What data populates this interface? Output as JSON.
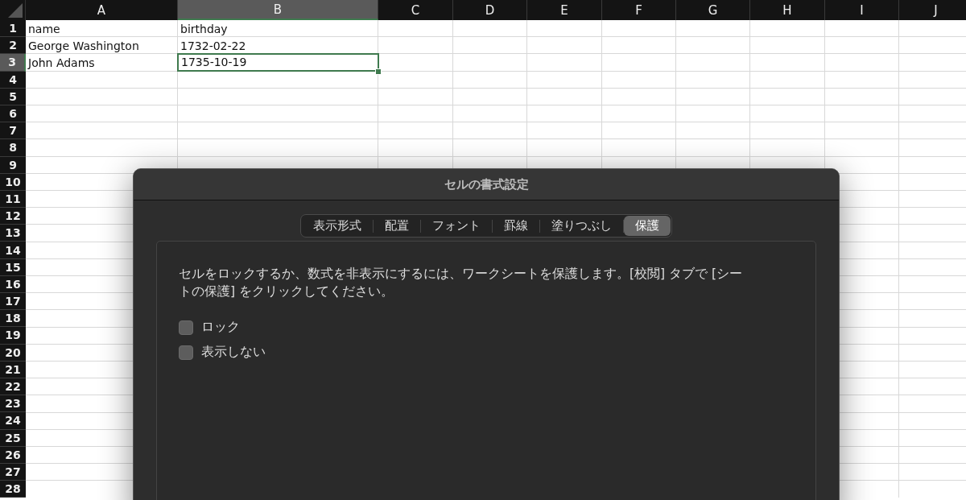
{
  "sheet": {
    "columns": [
      {
        "label": "A",
        "selected": false
      },
      {
        "label": "B",
        "selected": true
      },
      {
        "label": "C",
        "selected": false
      },
      {
        "label": "D",
        "selected": false
      },
      {
        "label": "E",
        "selected": false
      },
      {
        "label": "F",
        "selected": false
      },
      {
        "label": "G",
        "selected": false
      },
      {
        "label": "H",
        "selected": false
      },
      {
        "label": "I",
        "selected": false
      },
      {
        "label": "J",
        "selected": false
      }
    ],
    "rows": [
      {
        "label": "1",
        "selected": false,
        "cells": [
          {
            "text": "name",
            "selected": false
          },
          {
            "text": "birthday",
            "selected": false
          }
        ]
      },
      {
        "label": "2",
        "selected": false,
        "cells": [
          {
            "text": "George Washington",
            "selected": false
          },
          {
            "text": "1732-02-22",
            "selected": false
          }
        ]
      },
      {
        "label": "3",
        "selected": true,
        "cells": [
          {
            "text": "John Adams",
            "selected": false
          },
          {
            "text": "1735-10-19",
            "selected": true
          }
        ]
      },
      {
        "label": "4",
        "selected": false
      },
      {
        "label": "5",
        "selected": false
      },
      {
        "label": "6",
        "selected": false
      },
      {
        "label": "7",
        "selected": false
      },
      {
        "label": "8",
        "selected": false
      },
      {
        "label": "9",
        "selected": false
      },
      {
        "label": "10",
        "selected": false
      },
      {
        "label": "11",
        "selected": false
      },
      {
        "label": "12",
        "selected": false
      },
      {
        "label": "13",
        "selected": false
      },
      {
        "label": "14",
        "selected": false
      },
      {
        "label": "15",
        "selected": false
      },
      {
        "label": "16",
        "selected": false
      },
      {
        "label": "17",
        "selected": false
      },
      {
        "label": "18",
        "selected": false
      },
      {
        "label": "19",
        "selected": false
      },
      {
        "label": "20",
        "selected": false
      },
      {
        "label": "21",
        "selected": false
      },
      {
        "label": "22",
        "selected": false
      },
      {
        "label": "23",
        "selected": false
      },
      {
        "label": "24",
        "selected": false
      },
      {
        "label": "25",
        "selected": false
      },
      {
        "label": "26",
        "selected": false
      },
      {
        "label": "27",
        "selected": false
      },
      {
        "label": "28",
        "selected": false
      }
    ]
  },
  "dialog": {
    "title": "セルの書式設定",
    "tabs": [
      {
        "label": "表示形式",
        "selected": false
      },
      {
        "label": "配置",
        "selected": false
      },
      {
        "label": "フォント",
        "selected": false
      },
      {
        "label": "罫線",
        "selected": false
      },
      {
        "label": "塗りつぶし",
        "selected": false
      },
      {
        "label": "保護",
        "selected": true
      }
    ],
    "description": "セルをロックするか、数式を非表示にするには、ワークシートを保護します。[校閲] タブで [シートの保護] をクリックしてください。",
    "checkboxes": [
      {
        "label": "ロック",
        "checked": false
      },
      {
        "label": "表示しない",
        "checked": false
      }
    ]
  }
}
